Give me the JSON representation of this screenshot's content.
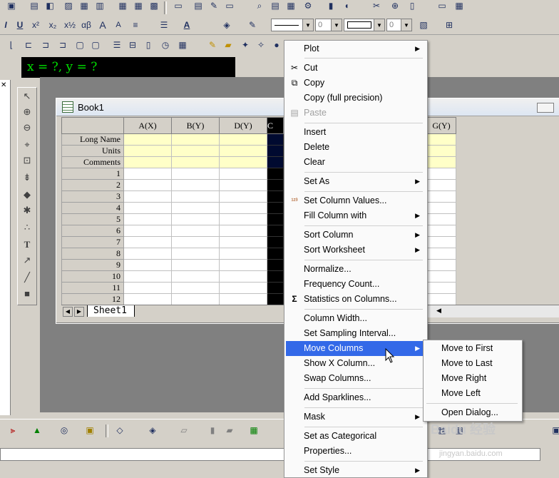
{
  "coord_readout": "x = ?, y = ?",
  "workbook": {
    "title": "Book1",
    "columns": [
      "A(X)",
      "B(Y)",
      "D(Y)",
      "C",
      "",
      "G(Y)"
    ],
    "row_labels": [
      "Long Name",
      "Units",
      "Comments"
    ],
    "rows": [
      "1",
      "2",
      "3",
      "4",
      "5",
      "6",
      "7",
      "8",
      "9",
      "10",
      "11",
      "12"
    ],
    "sheet_tab": "Sheet1"
  },
  "toolbar": {
    "line_width": "0",
    "font_size": "0"
  },
  "context_menu": {
    "items": [
      {
        "label": "Plot",
        "submenu": true
      },
      {
        "label": "Cut",
        "icon": "scissors-icon"
      },
      {
        "label": "Copy",
        "icon": "copy-icon"
      },
      {
        "label": "Copy (full precision)"
      },
      {
        "label": "Paste",
        "icon": "paste-icon",
        "disabled": true
      },
      {
        "label": "Insert"
      },
      {
        "label": "Delete"
      },
      {
        "label": "Clear"
      },
      {
        "label": "Set As",
        "submenu": true
      },
      {
        "label": "Set Column Values...",
        "icon": "set-values-icon"
      },
      {
        "label": "Fill Column with",
        "submenu": true
      },
      {
        "label": "Sort Column",
        "submenu": true
      },
      {
        "label": "Sort Worksheet",
        "submenu": true
      },
      {
        "label": "Normalize..."
      },
      {
        "label": "Frequency Count..."
      },
      {
        "label": "Statistics on Columns...",
        "icon": "sigma-icon"
      },
      {
        "label": "Column Width..."
      },
      {
        "label": "Set Sampling Interval..."
      },
      {
        "label": "Move Columns",
        "submenu": true,
        "highlighted": true
      },
      {
        "label": "Show X Column..."
      },
      {
        "label": "Swap Columns..."
      },
      {
        "label": "Add Sparklines..."
      },
      {
        "label": "Mask",
        "submenu": true
      },
      {
        "label": "Set as Categorical"
      },
      {
        "label": "Properties..."
      },
      {
        "label": "Set Style",
        "submenu": true
      }
    ],
    "highlight_color": "#3369e8"
  },
  "move_columns_submenu": {
    "items": [
      "Move to First",
      "Move to Last",
      "Move Right",
      "Move Left",
      "Open Dialog..."
    ]
  },
  "watermark": "Baidu 经验",
  "watermark_url": "jingyan.baidu.com"
}
